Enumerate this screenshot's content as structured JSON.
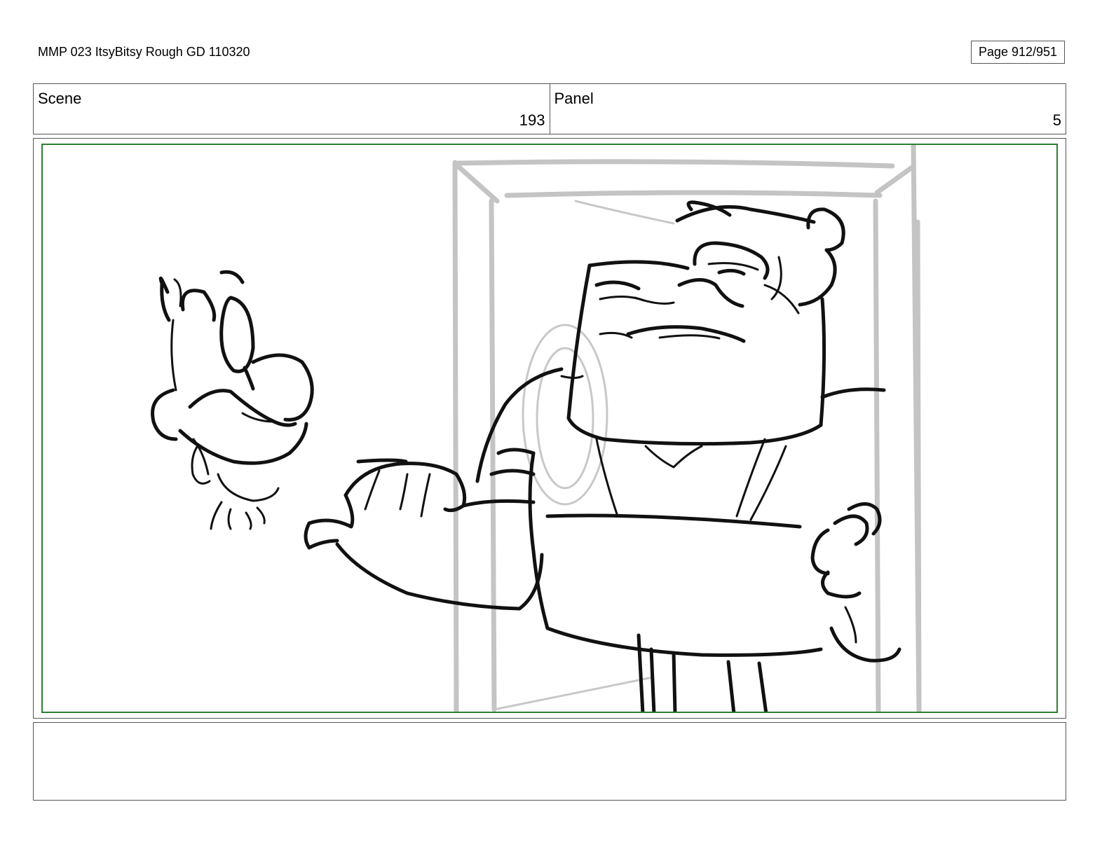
{
  "header": {
    "title": "MMP 023 ItsyBitsy Rough GD 110320",
    "page": "Page 912/951"
  },
  "scene": {
    "label": "Scene",
    "value": "193"
  },
  "panel": {
    "label": "Panel",
    "value": "5"
  },
  "colors": {
    "frame_border": "#2e7d32",
    "sketch_ink": "#111111",
    "rough_grey": "#c4c4c4"
  },
  "notes": {
    "text": ""
  }
}
